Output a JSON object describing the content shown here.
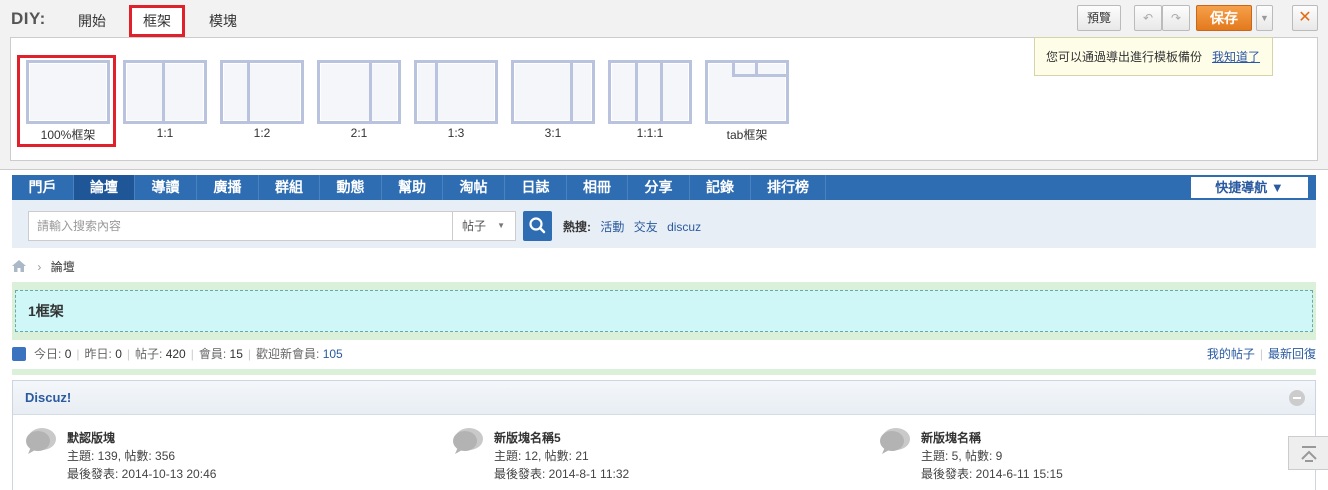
{
  "diy": {
    "title": "DIY:",
    "tabs": [
      "開始",
      "框架",
      "模塊"
    ],
    "frames": [
      "100%框架",
      "1:1",
      "1:2",
      "2:1",
      "1:3",
      "3:1",
      "1:1:1",
      "tab框架"
    ],
    "buttons": {
      "preview": "預覽",
      "undo": "↶",
      "redo": "↷",
      "save": "保存",
      "dropdown": "▼",
      "close": "✕"
    },
    "tip": {
      "text": "您可以通過導出進行模板備份",
      "link": "我知道了"
    }
  },
  "nav": {
    "items": [
      "門戶",
      "論壇",
      "導讀",
      "廣播",
      "群組",
      "動態",
      "幫助",
      "淘帖",
      "日誌",
      "相冊",
      "分享",
      "記錄",
      "排行榜"
    ],
    "active_index": 1,
    "quick": "快捷導航 ▼"
  },
  "search": {
    "placeholder": "請輸入搜索內容",
    "select": "帖子",
    "select_arrow": "▼",
    "hot_label": "熱搜:",
    "hot_terms": [
      "活動",
      "交友",
      "discuz"
    ]
  },
  "breadcrumb": {
    "sep": "›",
    "current": "論壇"
  },
  "frame_block": {
    "label": "1框架"
  },
  "stats": {
    "today_label": "今日:",
    "today": "0",
    "yesterday_label": "昨日:",
    "yesterday": "0",
    "posts_label": "帖子:",
    "posts": "420",
    "members_label": "會員:",
    "members": "15",
    "welcome_label": "歡迎新會員:",
    "welcome": "105",
    "my_posts": "我的帖子",
    "latest": "最新回復"
  },
  "category": {
    "title": "Discuz!",
    "forums": [
      {
        "name": "默認版塊",
        "counts": "主題: 139, 帖數: 356",
        "last": "最後發表: 2014-10-13 20:46"
      },
      {
        "name": "新版塊名稱5",
        "counts": "主題: 12, 帖數: 21",
        "last": "最後發表: 2014-8-1 11:32"
      },
      {
        "name": "新版塊名稱",
        "counts": "主題: 5, 帖數: 9",
        "last": "最後發表: 2014-6-11 15:15"
      }
    ]
  },
  "colors": {
    "nav_blue": "#2f6db3",
    "save_orange": "#e8852a",
    "highlight_red": "#e0202a"
  }
}
